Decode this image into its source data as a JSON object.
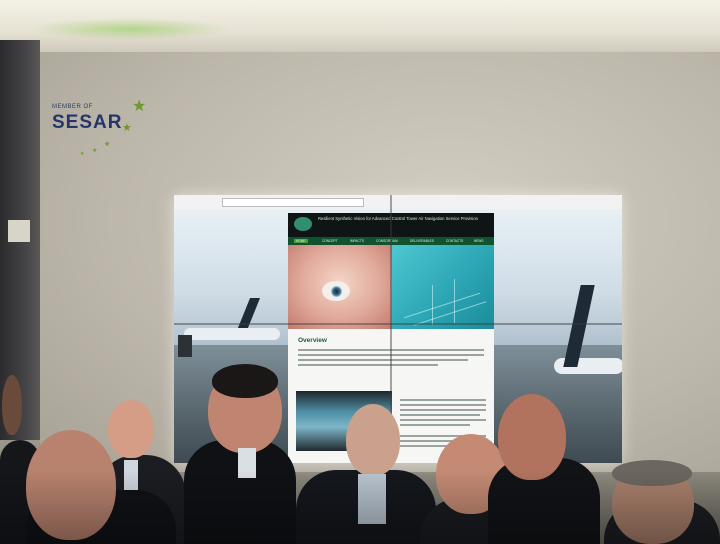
{
  "signage": {
    "member_label": "MEMBER OF",
    "brand": "SESAR"
  },
  "screen": {
    "page_title": "Resilient Synthetic Vision for Advanced Control Tower Air Navigation Service Provision",
    "nav_items": [
      "HOME",
      "CONCEPT",
      "IMPACTS",
      "CONSORTIUM",
      "DELIVERABLES",
      "CONTACTS",
      "NEWS"
    ],
    "section_heading": "Overview"
  },
  "colors": {
    "brand_blue": "#23356a",
    "star_green": "#6d9a2c",
    "web_header": "#0f1414",
    "web_nav": "#10542f",
    "web_heading": "#1d5a39"
  },
  "icons": [
    "star-icon",
    "eye-logo-icon"
  ]
}
